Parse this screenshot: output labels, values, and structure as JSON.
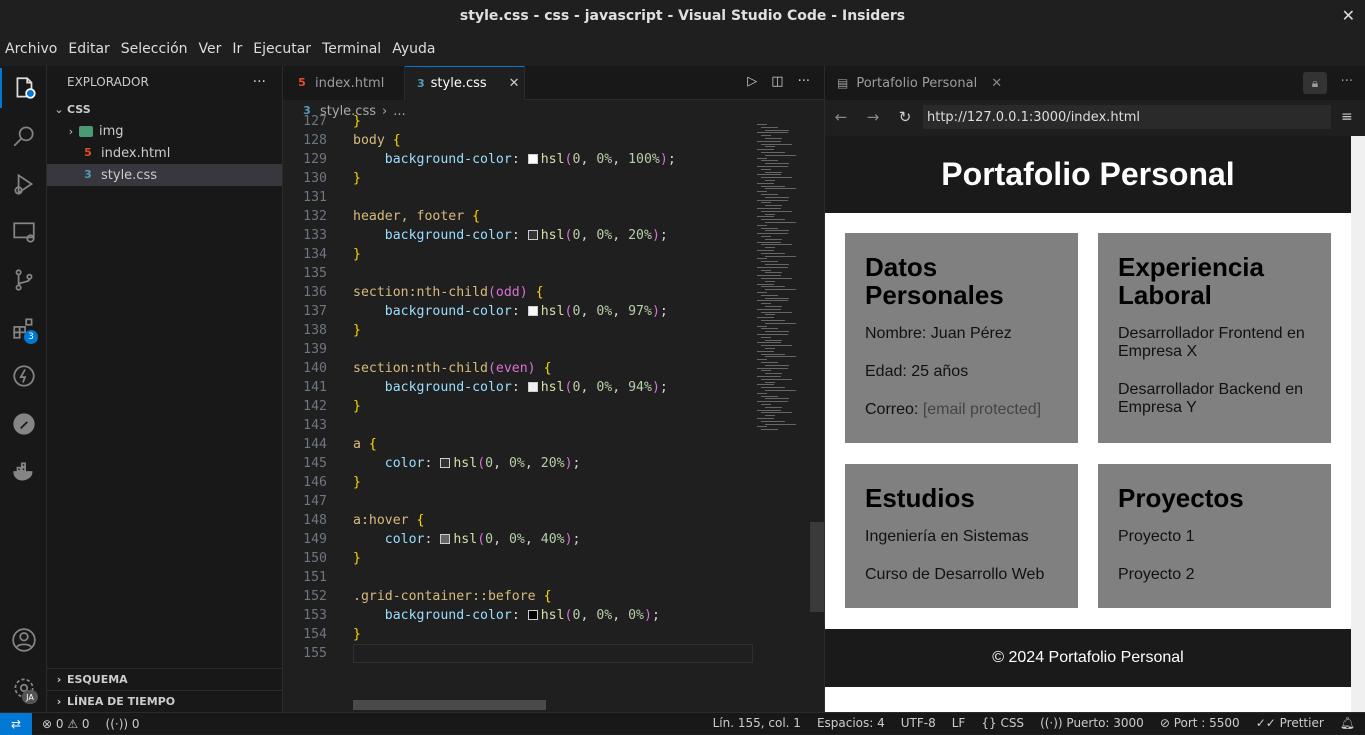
{
  "window": {
    "title": "style.css - css - javascript - Visual Studio Code - Insiders"
  },
  "menu": [
    "Archivo",
    "Editar",
    "Selección",
    "Ver",
    "Ir",
    "Ejecutar",
    "Terminal",
    "Ayuda"
  ],
  "activity": {
    "extensions_badge": "3",
    "account_initials": "JA"
  },
  "sidebar": {
    "title": "EXPLORADOR",
    "root": "CSS",
    "items": [
      {
        "label": "img",
        "type": "folder"
      },
      {
        "label": "index.html",
        "type": "html"
      },
      {
        "label": "style.css",
        "type": "css"
      }
    ],
    "outline": "ESQUEMA",
    "timeline": "LÍNEA DE TIEMPO"
  },
  "editor": {
    "tabs": [
      {
        "label": "index.html"
      },
      {
        "label": "style.css"
      }
    ],
    "breadcrumb": {
      "file": "style.css",
      "sep": "›",
      "more": "..."
    },
    "lines": [
      {
        "n": "128",
        "sel": "body",
        "brace": " {"
      },
      {
        "n": "129",
        "prop": "background-color",
        "swatch": "#ffffff",
        "fn": "hsl",
        "args": [
          "0",
          "0%",
          "100%"
        ]
      },
      {
        "n": "130",
        "close": "}"
      },
      {
        "n": "131"
      },
      {
        "n": "132",
        "sel": "header, footer",
        "brace": " {"
      },
      {
        "n": "133",
        "prop": "background-color",
        "swatch": "#333333",
        "fn": "hsl",
        "args": [
          "0",
          "0%",
          "20%"
        ]
      },
      {
        "n": "134",
        "close": "}"
      },
      {
        "n": "135"
      },
      {
        "n": "136",
        "sel": "section:nth-child",
        "paren": "(odd)",
        "brace": " {"
      },
      {
        "n": "137",
        "prop": "background-color",
        "swatch": "#f7f7f7",
        "fn": "hsl",
        "args": [
          "0",
          "0%",
          "97%"
        ]
      },
      {
        "n": "138",
        "close": "}"
      },
      {
        "n": "139"
      },
      {
        "n": "140",
        "sel": "section:nth-child",
        "paren": "(even)",
        "brace": " {"
      },
      {
        "n": "141",
        "prop": "background-color",
        "swatch": "#f0f0f0",
        "fn": "hsl",
        "args": [
          "0",
          "0%",
          "94%"
        ]
      },
      {
        "n": "142",
        "close": "}"
      },
      {
        "n": "143"
      },
      {
        "n": "144",
        "sel": "a",
        "brace": " {"
      },
      {
        "n": "145",
        "prop": "color",
        "swatch": "#333333",
        "fn": "hsl",
        "args": [
          "0",
          "0%",
          "20%"
        ]
      },
      {
        "n": "146",
        "close": "}"
      },
      {
        "n": "147"
      },
      {
        "n": "148",
        "sel": "a:hover",
        "brace": " {"
      },
      {
        "n": "149",
        "prop": "color",
        "swatch": "#666666",
        "fn": "hsl",
        "args": [
          "0",
          "0%",
          "40%"
        ]
      },
      {
        "n": "150",
        "close": "}"
      },
      {
        "n": "151"
      },
      {
        "n": "152",
        "sel": ".grid-container::before",
        "brace": " {"
      },
      {
        "n": "153",
        "prop": "background-color",
        "swatch": "#000000",
        "fn": "hsl",
        "args": [
          "0",
          "0%",
          "0%"
        ]
      },
      {
        "n": "154",
        "close": "}"
      },
      {
        "n": "155"
      }
    ],
    "partial_line": "127"
  },
  "browser": {
    "tab_title": "Portafolio Personal",
    "url": "http://127.0.0.1:3000/index.html",
    "page": {
      "header": "Portafolio Personal",
      "cards": [
        {
          "title": "Datos Personales",
          "lines": [
            "Nombre: Juan Pérez",
            "Edad: 25 años"
          ],
          "email_label": "Correo:",
          "email": "[email protected]"
        },
        {
          "title": "Experiencia Laboral",
          "lines": [
            "Desarrollador Frontend en Empresa X",
            "Desarrollador Backend en Empresa Y"
          ]
        },
        {
          "title": "Estudios",
          "lines": [
            "Ingeniería en Sistemas",
            "Curso de Desarrollo Web"
          ]
        },
        {
          "title": "Proyectos",
          "lines": [
            "Proyecto 1",
            "Proyecto 2"
          ]
        }
      ],
      "footer": "© 2024 Portafolio Personal"
    }
  },
  "status": {
    "errors": "0",
    "warnings": "0",
    "ports": "0",
    "position": "Lín. 155, col. 1",
    "spaces": "Espacios: 4",
    "encoding": "UTF-8",
    "eol": "LF",
    "language": "CSS",
    "port": "Puerto: 3000",
    "port2": "Port : 5500",
    "prettier": "Prettier"
  }
}
